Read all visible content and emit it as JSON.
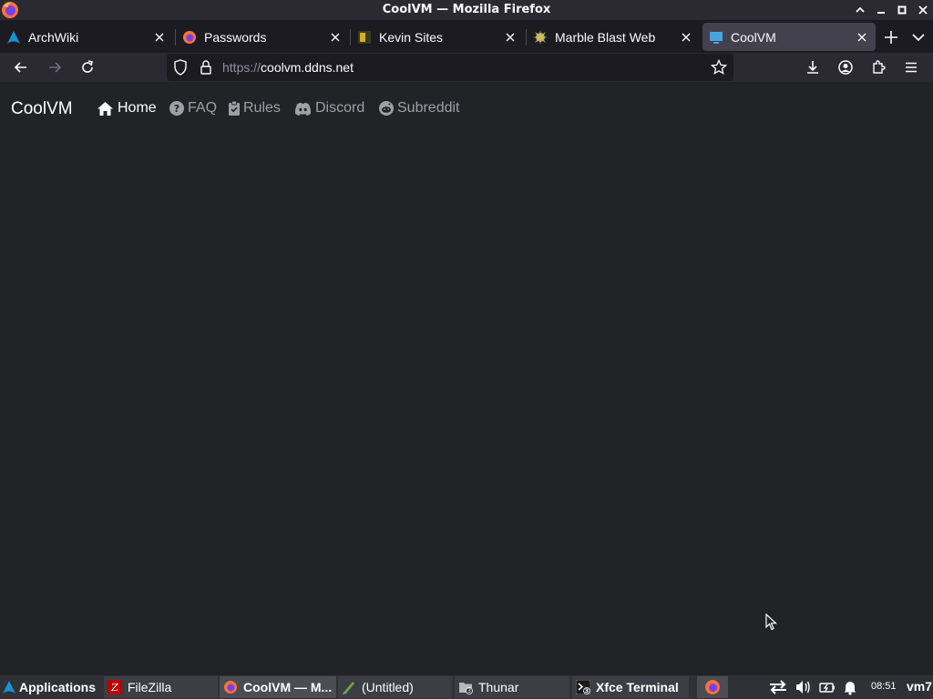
{
  "window": {
    "title": "CoolVM — Mozilla Firefox"
  },
  "tabs": [
    {
      "label": "ArchWiki",
      "icon": "archlinux-icon"
    },
    {
      "label": "Passwords",
      "icon": "firefox-icon"
    },
    {
      "label": "Kevin Sites",
      "icon": "kevin-sites-icon"
    },
    {
      "label": "Marble Blast Web",
      "icon": "marble-blast-icon"
    },
    {
      "label": "CoolVM",
      "icon": "monitor-icon",
      "active": true
    }
  ],
  "navbar": {
    "url_protocol": "https://",
    "url_host": "coolvm.ddns.net"
  },
  "site": {
    "brand": "CoolVM",
    "links": [
      {
        "label": "Home",
        "icon": "home-icon",
        "active": true
      },
      {
        "label": "FAQ",
        "icon": "question-circle-icon"
      },
      {
        "label": "Rules",
        "icon": "clipboard-check-icon"
      },
      {
        "label": "Discord",
        "icon": "discord-icon"
      },
      {
        "label": "Subreddit",
        "icon": "reddit-icon"
      }
    ]
  },
  "taskbar": {
    "applications_label": "Applications",
    "windows": [
      {
        "label": "FileZilla",
        "icon": "filezilla-icon"
      },
      {
        "label": "CoolVM — M...",
        "icon": "firefox-icon",
        "active": true
      },
      {
        "label": "(Untitled)",
        "icon": "mousepad-icon"
      },
      {
        "label": "Thunar",
        "icon": "folder-icon",
        "badge": "3"
      },
      {
        "label": "Xfce Terminal",
        "icon": "terminal-icon",
        "badge": "3"
      }
    ],
    "clock": "08:51",
    "hostname": "vm7"
  },
  "colors": {
    "page_bg": "#212327",
    "chrome_bg": "#2b2a33",
    "tabstrip_bg": "#1c1b22",
    "active_tab_bg": "#42414d",
    "taskbar_bg": "#2f3136",
    "nav_link_muted": "#9da1a6"
  }
}
